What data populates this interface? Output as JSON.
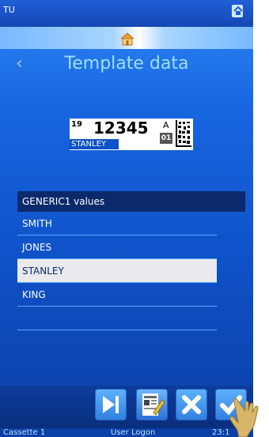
{
  "status_bar": {
    "app_label": "TU",
    "wifi_icon": "wifi-icon"
  },
  "home": {
    "icon": "home-icon"
  },
  "header": {
    "back_icon": "chevron-left-icon",
    "title": "Template data"
  },
  "label_preview": {
    "superscript": "19",
    "main_number": "12345",
    "letter": "A",
    "code_box": "01",
    "name": "STANLEY",
    "matrix_icon": "data-matrix-icon"
  },
  "values": {
    "header": "GENERIC1 values",
    "items": [
      "SMITH",
      "JONES",
      "STANLEY",
      "KING"
    ],
    "selected_index": 2
  },
  "toolbar": {
    "buttons": [
      {
        "name": "next-button",
        "icon": "skip-next-icon"
      },
      {
        "name": "edit-template-button",
        "icon": "edit-template-icon"
      },
      {
        "name": "cancel-button",
        "icon": "close-icon"
      },
      {
        "name": "confirm-button",
        "icon": "check-icon"
      }
    ]
  },
  "bottom_bar": {
    "left": "Cassette 1",
    "middle": "User Logon",
    "right": "23:1"
  },
  "colors": {
    "accent": "#9fe0ff",
    "background": "#1766e0",
    "header_bar": "#0a2a6b"
  }
}
